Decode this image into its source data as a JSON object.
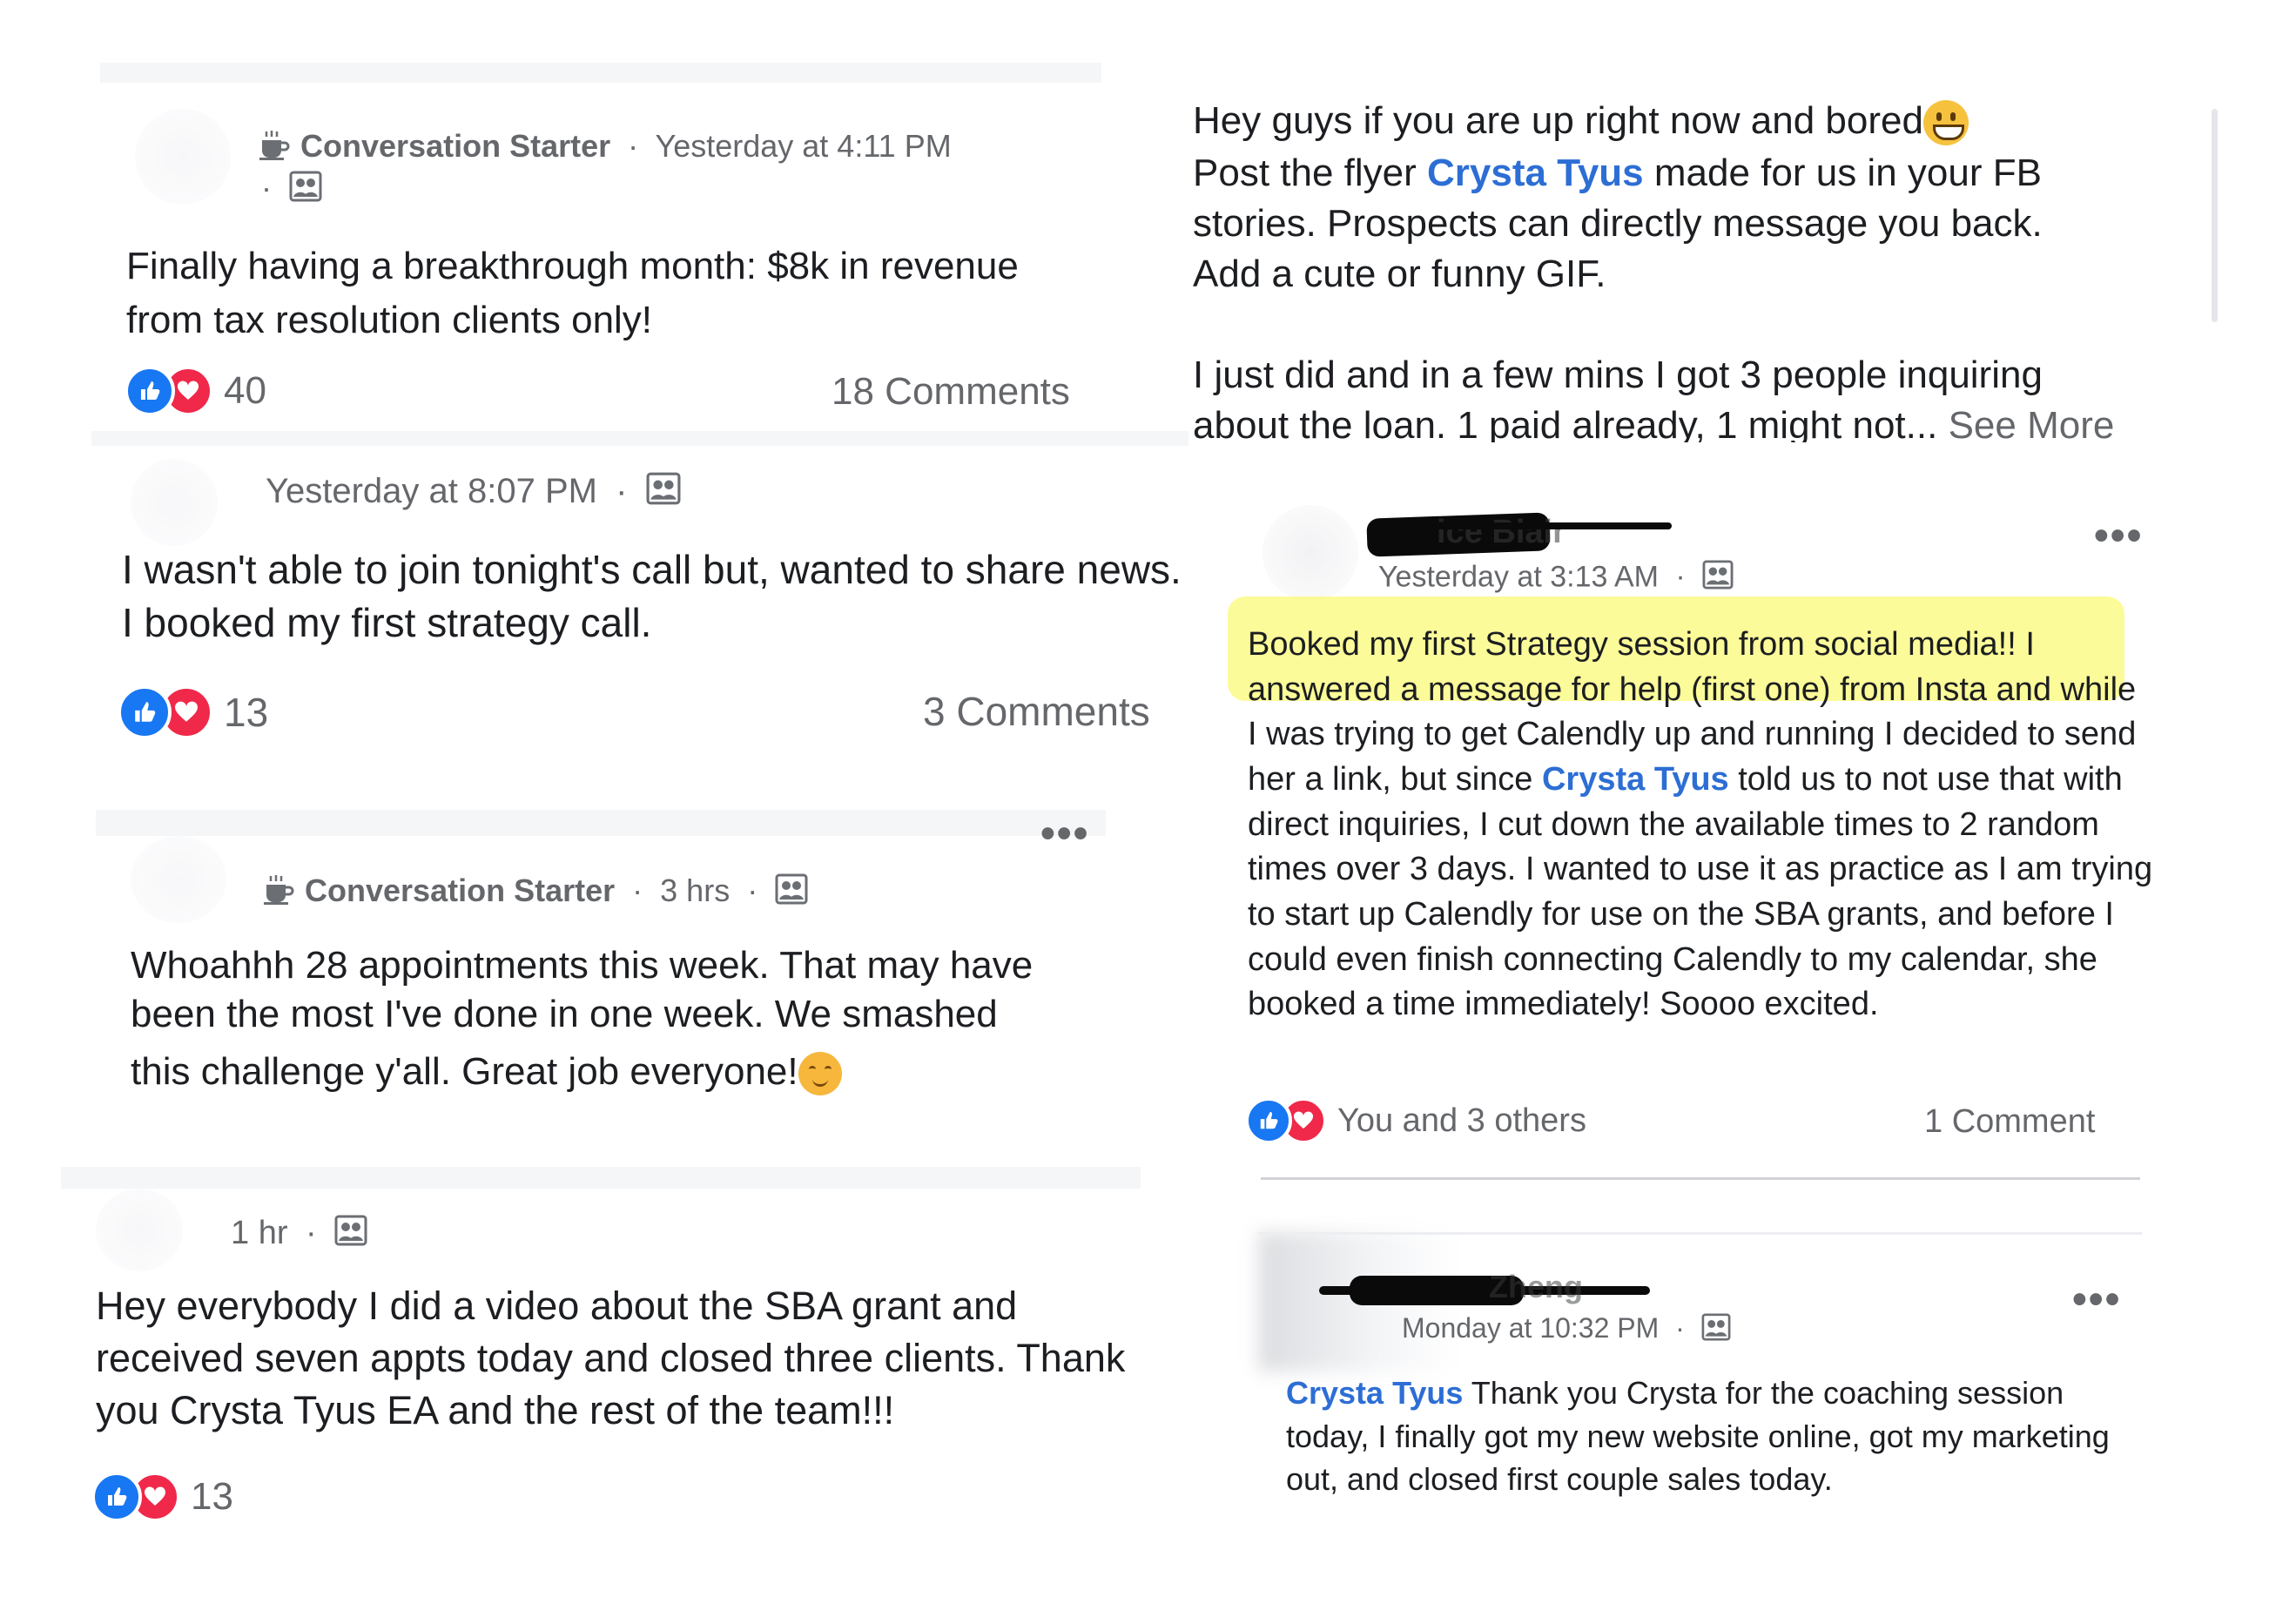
{
  "post1": {
    "group": "Conversation Starter",
    "time": "Yesterday at 4:11 PM",
    "body": "Finally having a breakthrough month: $8k in revenue from tax resolution clients only!",
    "reaction_count": "40",
    "comments": "18 Comments"
  },
  "post2": {
    "time": "Yesterday at 8:07 PM",
    "body": "I wasn't able to join tonight's call but, wanted to share news. I booked my first strategy call.",
    "reaction_count": "13",
    "comments": "3 Comments"
  },
  "post3": {
    "group": "Conversation Starter",
    "time": "3 hrs",
    "body_line1": "Whoahhh 28 appointments this week.  That may have",
    "body_line2": "been the most I've done in one week.  We smashed",
    "body_line3": "this challenge y'all.  Great job everyone!"
  },
  "post4": {
    "time": "1 hr",
    "body": "Hey everybody I did a video about the SBA grant and received seven appts today and closed three clients. Thank you Crysta Tyus EA and the rest of the team!!!",
    "reaction_count": "13"
  },
  "post5": {
    "line1": "Hey guys if you are up right now and bored",
    "line2_pre": "Post the flyer ",
    "mention": "Crysta Tyus",
    "line2_post": " made for us in your FB",
    "line3": "stories. Prospects can directly message you back.",
    "line4": "Add  a cute or funny GIF.",
    "line5": "I just did and in a few mins I got 3 people inquiring",
    "line6": "about the loan. 1 paid already, 1 might not...",
    "see_more": "See More"
  },
  "post6": {
    "name_fragment": "ice Blair",
    "time": "Yesterday at 3:13 AM",
    "highlight": "Booked my first Strategy session from social media!!",
    "body_after_highlight": " I answered a message for help (first one) from Insta and while I was trying to get Calendly up and running I decided to send her a link, but since ",
    "mention": "Crysta Tyus",
    "body_rest": " told us to not use that with direct inquiries, I cut down the available times to 2 random times over 3 days. I wanted to use it as practice as I am trying to start up Calendly for use on the SBA grants, and before I could even finish connecting Calendly to my calendar, she booked a time immediately!  Soooo excited.",
    "reactions": "You and 3 others",
    "comments": "1 Comment"
  },
  "post7": {
    "name_fragment": "Zheng",
    "time": "Monday at 10:32 PM",
    "mention": "Crysta Tyus",
    "body": " Thank you Crysta for the coaching session today, I finally got my new website online, got my marketing out, and closed first couple sales today."
  },
  "colors": {
    "like": "#1877f2",
    "love": "#f02849",
    "link": "#2d6ed4",
    "highlight": "#faf846"
  },
  "icons": [
    "coffee-icon",
    "group-privacy-icon",
    "like-icon",
    "love-icon",
    "more-icon"
  ]
}
